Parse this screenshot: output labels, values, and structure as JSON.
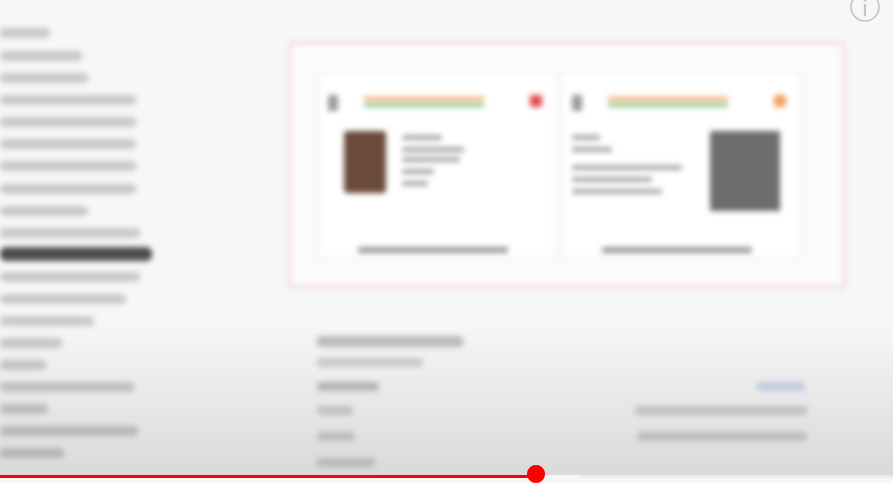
{
  "player": {
    "progress": 0.6,
    "buffered": 0.65,
    "accent_color": "#ff0000",
    "info_icon": "info-icon"
  },
  "colors": {
    "frame_border": "#f2c5cd",
    "sidebar_active": "#4c4c4c"
  }
}
